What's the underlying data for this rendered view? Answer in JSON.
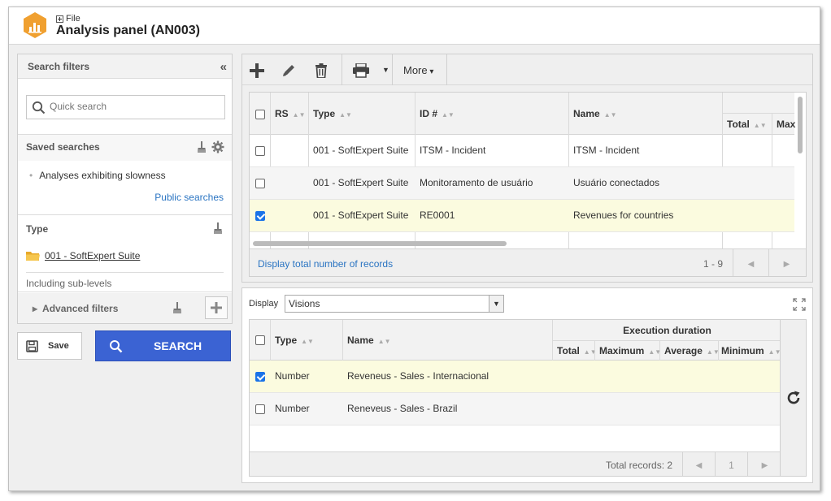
{
  "titlebar": {
    "menu_file": "File",
    "title": "Analysis panel (AN003)"
  },
  "left": {
    "header": "Search filters",
    "search_placeholder": "Quick search",
    "saved_title": "Saved searches",
    "saved_items": [
      "Analyses exhibiting slowness"
    ],
    "public_link": "Public searches",
    "type_title": "Type",
    "type_value": "001 - SoftExpert Suite",
    "sub_levels": "Including sub-levels",
    "advanced": "Advanced filters",
    "save_label": "Save",
    "search_label": "SEARCH"
  },
  "toolbar": {
    "more_label": "More"
  },
  "grid1": {
    "columns": [
      "RS",
      "Type",
      "ID #",
      "Name",
      "Total",
      "Max"
    ],
    "rows": [
      {
        "type": "001 - SoftExpert Suite",
        "id": "ITSM - Incident",
        "name": "ITSM - Incident",
        "checked": false
      },
      {
        "type": "001 - SoftExpert Suite",
        "id": "Monitoramento de usuário",
        "name": "Usuário conectados",
        "checked": false
      },
      {
        "type": "001 - SoftExpert Suite",
        "id": "RE0001",
        "name": "Revenues for countries",
        "checked": true
      }
    ],
    "footer_link": "Display total number of records",
    "footer_count": "1 - 9"
  },
  "bottom": {
    "display_label": "Display",
    "display_value": "Visions",
    "group_header": "Execution duration",
    "columns": [
      "Type",
      "Name",
      "Total",
      "Maximum",
      "Average",
      "Minimum"
    ],
    "rows": [
      {
        "type": "Number",
        "name": "Reveneus - Sales - Internacional",
        "checked": true
      },
      {
        "type": "Number",
        "name": "Reneveus - Sales - Brazil",
        "checked": false
      }
    ],
    "total_records": "Total records: 2",
    "page": "1"
  },
  "colors": {
    "accent": "#3b63d3",
    "link": "#2a74c2",
    "highlight": "#fbfbdf",
    "icon_orange": "#f0a030"
  }
}
